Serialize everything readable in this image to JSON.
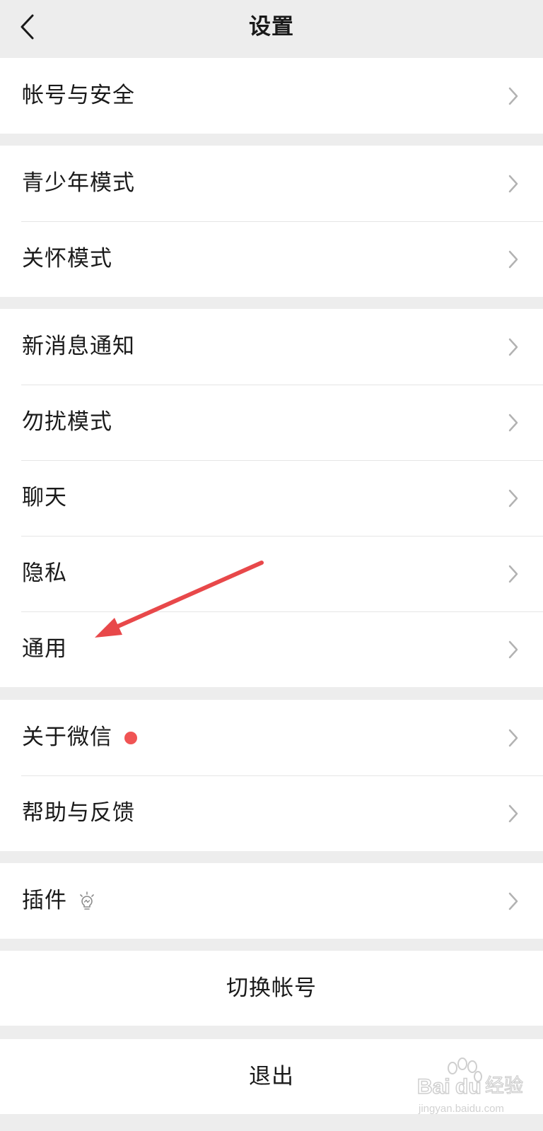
{
  "header": {
    "title": "设置",
    "back_icon": "chevron-left-icon"
  },
  "groups": [
    {
      "items": [
        {
          "label": "帐号与安全"
        }
      ]
    },
    {
      "items": [
        {
          "label": "青少年模式"
        },
        {
          "label": "关怀模式"
        }
      ]
    },
    {
      "items": [
        {
          "label": "新消息通知"
        },
        {
          "label": "勿扰模式"
        },
        {
          "label": "聊天"
        },
        {
          "label": "隐私"
        },
        {
          "label": "通用"
        }
      ]
    },
    {
      "items": [
        {
          "label": "关于微信",
          "badge": "red-dot"
        },
        {
          "label": "帮助与反馈"
        }
      ]
    },
    {
      "items": [
        {
          "label": "插件",
          "icon": "lightbulb-icon"
        }
      ]
    }
  ],
  "actions": {
    "switch_account": "切换帐号",
    "logout": "退出"
  },
  "annotation": {
    "arrow_target": "通用",
    "arrow_color": "#e8484a"
  },
  "watermark": {
    "text_latin": "Bai",
    "text_du": "du",
    "text_cn": "经验",
    "subtext": "jingyan.baidu.com"
  },
  "colors": {
    "background": "#ededed",
    "card": "#ffffff",
    "badge": "#f05454",
    "chevron": "#b2b2b2"
  }
}
